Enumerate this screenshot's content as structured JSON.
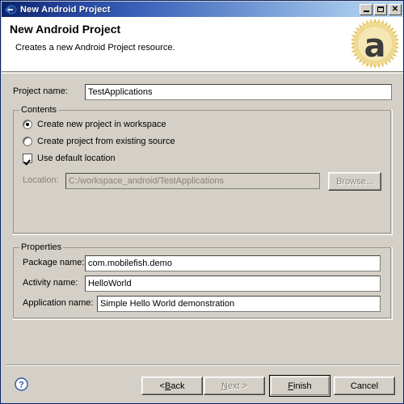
{
  "window": {
    "title": "New Android Project",
    "icon": "eclipse-wizard-icon",
    "minimize_label": "Minimize",
    "maximize_label": "Maximize",
    "close_label": "Close",
    "close_glyph": "✕"
  },
  "header": {
    "title": "New Android Project",
    "subtitle": "Creates a new Android Project resource.",
    "badge_icon": "android-gold-badge-icon",
    "badge_letter": "a"
  },
  "project_name": {
    "label": "Project name:",
    "value": "TestApplications"
  },
  "contents": {
    "legend": "Contents",
    "radios": [
      {
        "label": "Create new project in workspace",
        "checked": true
      },
      {
        "label": "Create project from existing source",
        "checked": false
      }
    ],
    "checkbox": {
      "label": "Use default location",
      "checked": true
    },
    "location": {
      "label": "Location:",
      "value": "C:/workspace_android/TestApplications",
      "disabled": true
    },
    "browse_button": {
      "label": "Browse...",
      "disabled": true
    }
  },
  "properties": {
    "legend": "Properties",
    "fields": [
      {
        "label": "Package name:",
        "value": "com.mobilefish.demo"
      },
      {
        "label": "Activity name:",
        "value": "HelloWorld"
      },
      {
        "label": "Application name:",
        "value": "Simple Hello World demonstration"
      }
    ]
  },
  "footer": {
    "help_icon": "help-question-icon",
    "buttons": [
      {
        "name": "back",
        "pre": "< ",
        "mnemonic": "B",
        "post": "ack",
        "disabled": false,
        "default": false
      },
      {
        "name": "next",
        "pre": "",
        "mnemonic": "N",
        "post": "ext >",
        "disabled": true,
        "default": false
      },
      {
        "name": "finish",
        "pre": "",
        "mnemonic": "F",
        "post": "inish",
        "disabled": false,
        "default": true
      },
      {
        "name": "cancel",
        "pre": "Cancel",
        "mnemonic": "",
        "post": "",
        "disabled": false,
        "default": false
      }
    ]
  },
  "colors": {
    "title_start": "#0a246a",
    "title_end": "#b8d4f0",
    "dialog_bg": "#d4d0c8",
    "badge_gold": "#e8c766",
    "help_blue": "#2a56a8"
  }
}
